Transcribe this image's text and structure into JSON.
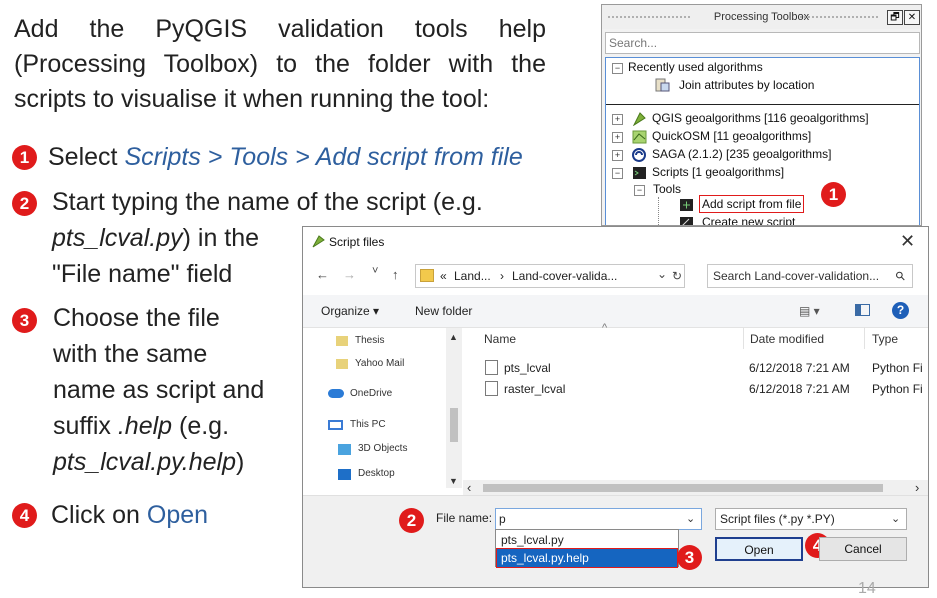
{
  "intro": {
    "lines": [
      "Add the PyQGIS validation tools help",
      "(Processing Toolbox) to the folder with the",
      "scripts to visualise it when running the tool:"
    ]
  },
  "steps": {
    "s1": {
      "num": "1",
      "pre": "Select ",
      "path": "Scripts > Tools > Add script from file"
    },
    "s2": {
      "num": "2",
      "l1": "Start typing the name of the script (e.g.",
      "l2a": "pts_lcval.py",
      "l2b": ") in the",
      "l3": "\"File name\" field"
    },
    "s3": {
      "num": "3",
      "l1": "Choose the file",
      "l2": "with the same",
      "l3": "name as script and",
      "l4a": "suffix ",
      "l4b": ".help",
      "l4c": " (e.g.",
      "l5a": "pts_lcval.py.help",
      "l5b": ")"
    },
    "s4": {
      "num": "4",
      "pre": "Click on ",
      "action": "Open"
    }
  },
  "toolbox": {
    "title": "Processing Toolbox",
    "btn_float": "🗗",
    "btn_close": "✕",
    "search_placeholder": "Search...",
    "items": {
      "recent": "Recently used algorithms",
      "join": "Join attributes by location",
      "qgis": "QGIS geoalgorithms [116 geoalgorithms]",
      "quickosm": "QuickOSM [11 geoalgorithms]",
      "saga": "SAGA (2.1.2) [235 geoalgorithms]",
      "scripts": "Scripts [1 geoalgorithms]",
      "tools": "Tools",
      "add_script": "Add script from file",
      "create_script": "Create new script"
    },
    "expand_minus": "−",
    "expand_plus": "+",
    "badge": "1"
  },
  "dialog": {
    "title": "Script files",
    "close": "✕",
    "nav": {
      "back": "←",
      "forward": "→",
      "recent": "˅",
      "up": "↑",
      "refresh": "↻"
    },
    "path": {
      "prefix": "«",
      "seg1": "Land...",
      "sep": "›",
      "seg2": "Land-cover-valida...",
      "arrow": "⌄"
    },
    "search_placeholder": "Search Land-cover-validation...",
    "search_glyph": "⚲",
    "toolbar": {
      "organize": "Organize ▾",
      "new_folder": "New folder",
      "view": "▤ ▾",
      "help": "?"
    },
    "columns": {
      "name": "Name",
      "date": "Date modified",
      "type": "Type"
    },
    "files": [
      {
        "name": "pts_lcval",
        "date": "6/12/2018 7:21 AM",
        "type": "Python Fi"
      },
      {
        "name": "raster_lcval",
        "date": "6/12/2018 7:21 AM",
        "type": "Python Fi"
      }
    ],
    "nav_items": [
      "Thesis",
      "Yahoo Mail",
      "OneDrive",
      "This PC",
      "3D Objects",
      "Desktop"
    ],
    "file_name_label": "File name:",
    "file_name_value": "p",
    "filter": "Script files (*.py *.PY)",
    "dropdown": [
      "pts_lcval.py",
      "pts_lcval.py.help"
    ],
    "open": "Open",
    "cancel": "Cancel",
    "badges": {
      "b2": "2",
      "b3": "3",
      "b4": "4"
    }
  },
  "page_number": "14",
  "colors": {
    "badge_red": "#e01b1b",
    "accent_blue": "#2e5f9e",
    "selection_blue": "#1565c0"
  }
}
